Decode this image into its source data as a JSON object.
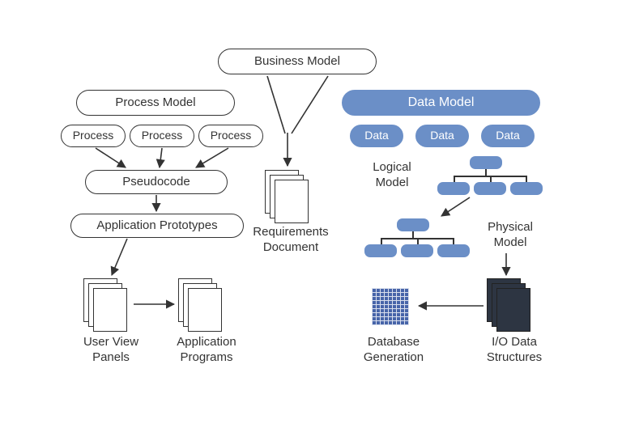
{
  "nodes": {
    "business_model": "Business Model",
    "process_model": "Process Model",
    "data_model": "Data Model",
    "process1": "Process",
    "process2": "Process",
    "process3": "Process",
    "data1": "Data",
    "data2": "Data",
    "data3": "Data",
    "pseudocode": "Pseudocode",
    "application_prototypes": "Application Prototypes"
  },
  "labels": {
    "requirements_document": "Requirements\nDocument",
    "logical_model": "Logical\nModel",
    "physical_model": "Physical\nModel",
    "user_view_panels": "User View\nPanels",
    "application_programs": "Application\nPrograms",
    "database_generation": "Database\nGeneration",
    "io_data_structures": "I/O Data\nStructures"
  },
  "colors": {
    "accent_blue": "#6b8fc7",
    "grid_blue": "#4764a9",
    "dark_fill": "#2d3542",
    "stroke": "#333333"
  }
}
